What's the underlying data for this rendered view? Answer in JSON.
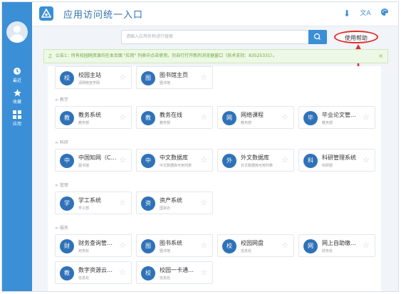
{
  "app": {
    "title": "应用访问统一入口"
  },
  "sidebar": {
    "items": [
      {
        "label": "最近",
        "icon": "clock-icon"
      },
      {
        "label": "收藏",
        "icon": "star-icon"
      },
      {
        "label": "应用",
        "icon": "grid-icon"
      }
    ]
  },
  "toolbar": {
    "icons": [
      "download-icon",
      "translate-icon",
      "palette-icon"
    ],
    "download_glyph": "⬇",
    "translate_glyph": "文A",
    "palette_glyph": "🎨"
  },
  "search": {
    "placeholder": "请输入应用名称进行搜索"
  },
  "help": {
    "label": "使用帮助"
  },
  "notice": {
    "text": "公告1：所有校园网资源均在本页面 \"应用\" 列表中点击使用，勿自行打开新的浏览器窗口（技术支持：83525331）。",
    "close": "×",
    "icon_glyph": "♫"
  },
  "star_glyph": "☆",
  "sections": {
    "top": {
      "tiles": [
        {
          "icon": "校",
          "name": "校园主站",
          "sub": "清网络宣学网"
        },
        {
          "icon": "图",
          "name": "图书馆主页",
          "sub": "图书馆"
        }
      ]
    },
    "teaching": {
      "label": "教学",
      "tiles": [
        {
          "icon": "教",
          "name": "教务系统",
          "sub": "教务部"
        },
        {
          "icon": "教",
          "name": "教务在线",
          "sub": "教务部"
        },
        {
          "icon": "网",
          "name": "网络课程",
          "sub": "教务部"
        },
        {
          "icon": "毕",
          "name": "毕业论文管…",
          "sub": "教务部"
        }
      ]
    },
    "research": {
      "label": "科研",
      "tiles": [
        {
          "icon": "中",
          "name": "中国知网（C…",
          "sub": "图书馆"
        },
        {
          "icon": "中",
          "name": "中文数据库",
          "sub": "中文数据库可用列表"
        },
        {
          "icon": "外",
          "name": "外文数据库",
          "sub": "外文数据库可用列表"
        },
        {
          "icon": "科",
          "name": "科研管理系统",
          "sub": "科研部"
        }
      ]
    },
    "management": {
      "label": "管理",
      "tiles": [
        {
          "icon": "学",
          "name": "学工系统",
          "sub": "学工部"
        },
        {
          "icon": "资",
          "name": "资产系统",
          "sub": "国资办"
        }
      ]
    },
    "service": {
      "label": "服务",
      "tiles": [
        {
          "icon": "财",
          "name": "财务查询管…",
          "sub": "财务处"
        },
        {
          "icon": "图",
          "name": "图书系统",
          "sub": "图书馆"
        },
        {
          "icon": "校",
          "name": "校园网盘",
          "sub": "信息处"
        },
        {
          "icon": "网",
          "name": "网上自助缴…",
          "sub": "财务处"
        },
        {
          "icon": "教",
          "name": "数字资源云…",
          "sub": "信息处"
        },
        {
          "icon": "校",
          "name": "校园一卡通…",
          "sub": "信息处"
        }
      ]
    }
  },
  "colors": {
    "sidebar": "#3a8fd6",
    "tile_icon": "#2f72b8",
    "highlight": "#e02d2d",
    "notice_text": "#6aa93a"
  }
}
